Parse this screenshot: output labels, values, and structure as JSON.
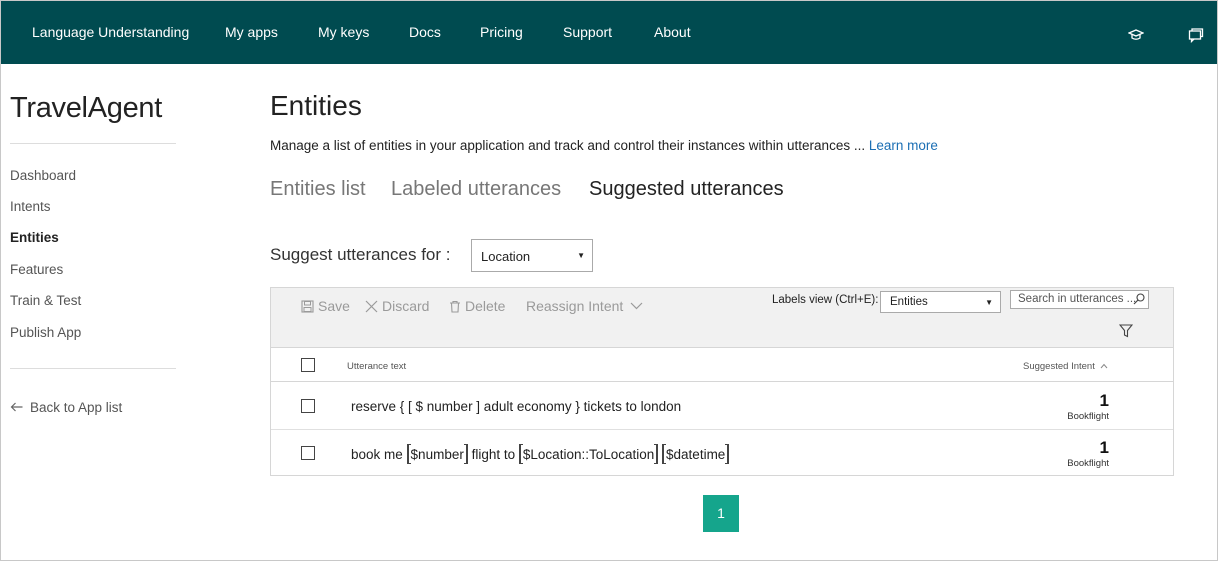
{
  "topbar": {
    "nav": [
      "Language Understanding",
      "My apps",
      "My keys",
      "Docs",
      "Pricing",
      "Support",
      "About"
    ],
    "icons": [
      "graduation-cap-icon",
      "chat-icon"
    ],
    "background": "#004b50"
  },
  "sidebar": {
    "app_name": "TravelAgent",
    "items": [
      {
        "label": "Dashboard",
        "active": false
      },
      {
        "label": "Intents",
        "active": false
      },
      {
        "label": "Entities",
        "active": true
      },
      {
        "label": "Features",
        "active": false
      },
      {
        "label": "Train & Test",
        "active": false
      },
      {
        "label": "Publish App",
        "active": false
      }
    ],
    "back_label": "Back to App list"
  },
  "main": {
    "title": "Entities",
    "description": "Manage a list of entities in your application and track and control their instances within utterances ... ",
    "learn_more": "Learn more",
    "tabs": [
      {
        "label": "Entities list",
        "active": false
      },
      {
        "label": "Labeled utterances",
        "active": false
      },
      {
        "label": "Suggested utterances",
        "active": true
      }
    ],
    "suggest_label": "Suggest utterances for :",
    "suggest_select": "Location"
  },
  "toolbar": {
    "save": "Save",
    "discard": "Discard",
    "delete": "Delete",
    "reassign": "Reassign Intent",
    "labels_view_label": "Labels view (Ctrl+E):",
    "labels_view_value": "Entities",
    "search_placeholder": "Search in utterances ..."
  },
  "table": {
    "col_utterance": "Utterance text",
    "col_intent": "Suggested Intent",
    "rows": [
      {
        "text": "reserve { [ $ number ] adult economy } tickets to london",
        "count": "1",
        "intent": "Bookflight"
      },
      {
        "prefix": "book me",
        "token1": "$number",
        "middle": "flight to",
        "token2": "$Location::ToLocation",
        "token3": "$datetime",
        "count": "1",
        "intent": "Bookflight"
      }
    ]
  },
  "pagination": {
    "current": "1",
    "accent": "#15a58c"
  }
}
